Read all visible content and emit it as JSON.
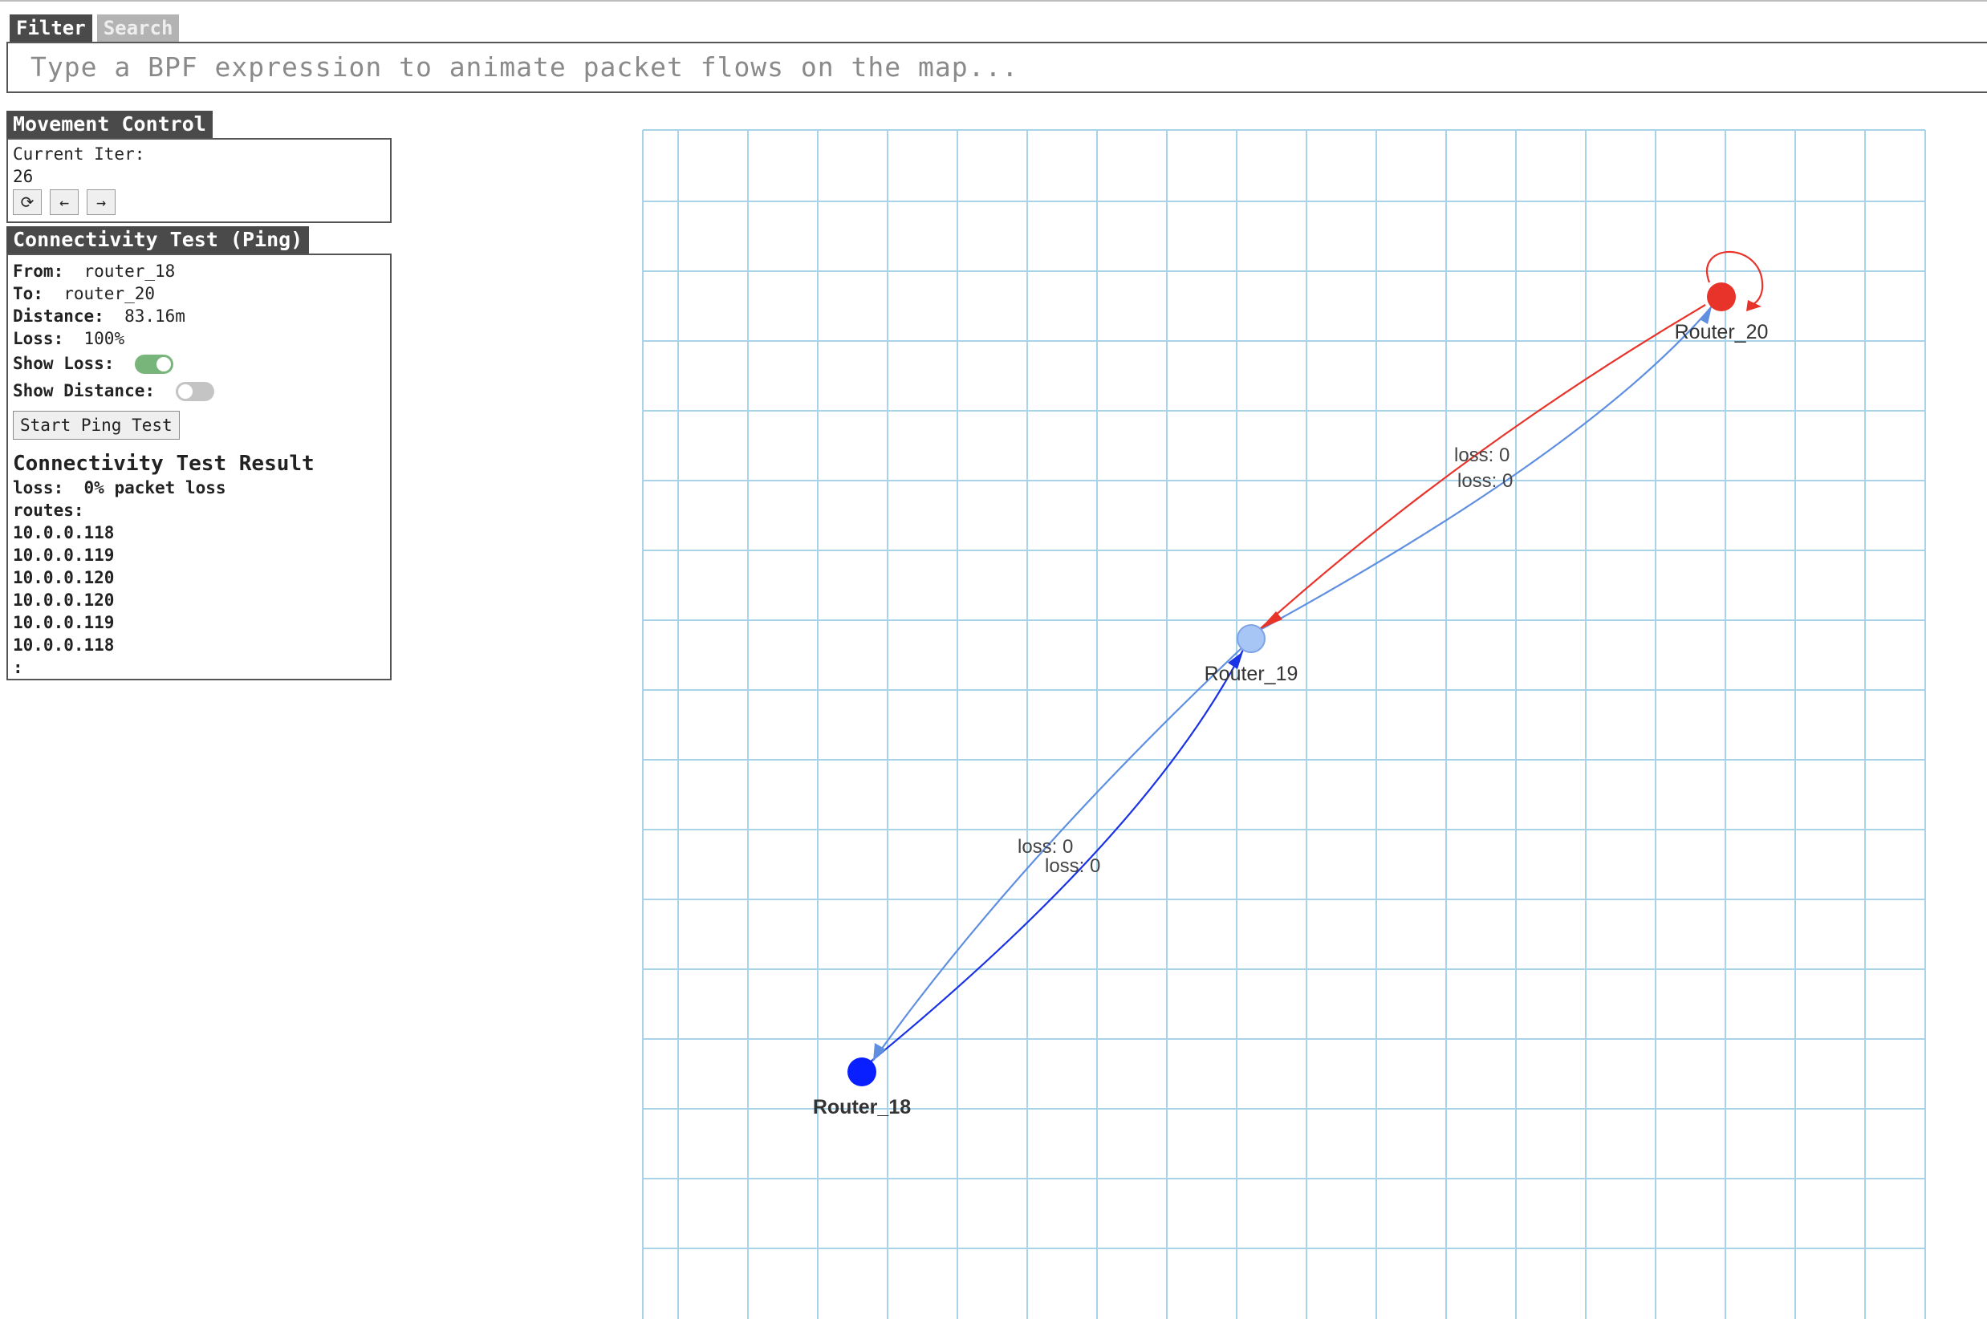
{
  "filter": {
    "tabs": [
      "Filter",
      "Search"
    ],
    "placeholder": "Type a BPF expression to animate packet flows on the map..."
  },
  "movement": {
    "title": "Movement Control",
    "iter_label": "Current Iter:",
    "iter_value": "26",
    "buttons": [
      "reset-icon",
      "arrow-left-icon",
      "arrow-right-icon"
    ],
    "button_glyphs": [
      "⟳",
      "←",
      "→"
    ]
  },
  "ping": {
    "title": "Connectivity Test (Ping)",
    "from_label": "From:",
    "from_value": "router_18",
    "to_label": "To:",
    "to_value": "router_20",
    "distance_label": "Distance:",
    "distance_value": "83.16m",
    "loss_label": "Loss:",
    "loss_value": "100%",
    "show_loss_label": "Show Loss:",
    "show_loss": true,
    "show_distance_label": "Show Distance:",
    "show_distance": false,
    "start_button": "Start Ping Test"
  },
  "result": {
    "title": "Connectivity Test Result",
    "loss_label": "loss:",
    "loss_value": "0% packet loss",
    "routes_label": "routes:",
    "routes": [
      "10.0.0.118",
      "10.0.0.119",
      "10.0.0.120",
      "10.0.0.120",
      "10.0.0.119",
      "10.0.0.118"
    ],
    "terminator": ":"
  },
  "map": {
    "nodes": [
      {
        "label": "Router_18",
        "color": "#0a1fff",
        "bold": true
      },
      {
        "label": "Router_19",
        "color": "#a7c6f5",
        "bold": false
      },
      {
        "label": "Router_20",
        "color": "#e8332a",
        "bold": false
      }
    ],
    "edges": [
      {
        "from": "Router_18",
        "to": "Router_19",
        "label": "loss: 0",
        "color": "#1a32e6"
      },
      {
        "from": "Router_19",
        "to": "Router_18",
        "label": "loss: 0",
        "color": "#5f8fe0"
      },
      {
        "from": "Router_19",
        "to": "Router_20",
        "label": "loss: 0",
        "color": "#5f8fe0"
      },
      {
        "from": "Router_20",
        "to": "Router_19",
        "label": "loss: 0",
        "color": "#e8332a"
      },
      {
        "from": "Router_20",
        "to": "Router_20",
        "label": "",
        "color": "#e8332a"
      }
    ],
    "grid_color": "#a9d3e8"
  }
}
